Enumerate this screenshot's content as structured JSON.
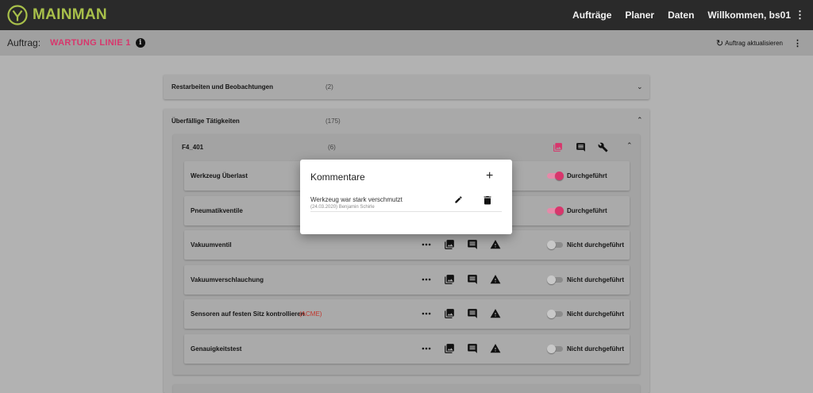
{
  "app": {
    "logo_text": "MAINMAN",
    "brand_color": "#a8c04a",
    "accent_color": "#d8366c"
  },
  "nav": {
    "items": [
      "Aufträge",
      "Planer",
      "Daten"
    ],
    "user": "Willkommen, bs01",
    "menu_icon": "more-vert-icon"
  },
  "order": {
    "label": "Auftrag:",
    "value": "WARTUNG LINIE 1",
    "info_icon": "info-icon",
    "refresh_label": "Auftrag aktualisieren",
    "refresh_icon": "refresh-icon",
    "menu_icon": "more-vert-icon"
  },
  "sections": [
    {
      "title": "Restarbeiten und Beobachtungen",
      "count": "(2)",
      "expanded": false
    },
    {
      "title": "Überfällige Tätigkeiten",
      "count": "(175)",
      "expanded": true
    }
  ],
  "group": {
    "title": "F4_401",
    "count": "(6)",
    "icons": [
      "photo-library-icon",
      "comment-icon",
      "wrench-icon"
    ]
  },
  "task_icons": [
    "more-horiz-icon",
    "photo-library-icon",
    "comment-icon",
    "warning-icon"
  ],
  "tasks": [
    {
      "name": "Werkzeug Überlast",
      "tag": "",
      "status": "Durchgeführt",
      "done": true
    },
    {
      "name": "Pneumatikventile",
      "tag": "",
      "status": "Durchgeführt",
      "done": true
    },
    {
      "name": "Vakuumventil",
      "tag": "",
      "status": "Nicht durchgeführt",
      "done": false
    },
    {
      "name": "Vakuumverschlauchung",
      "tag": "",
      "status": "Nicht durchgeführt",
      "done": false
    },
    {
      "name": "Sensoren auf festen Sitz kontrollieren",
      "tag": "(ACME)",
      "status": "Nicht durchgeführt",
      "done": false
    },
    {
      "name": "Genauigkeitstest",
      "tag": "",
      "status": "Nicht durchgeführt",
      "done": false
    }
  ],
  "modal": {
    "title": "Kommentare",
    "add_icon": "add-icon",
    "comments": [
      {
        "text": "Werkzeug war stark verschmutzt",
        "meta": "(24.03.2020) Benjamin Schirle",
        "edit_icon": "edit-icon",
        "delete_icon": "delete-icon"
      }
    ]
  }
}
